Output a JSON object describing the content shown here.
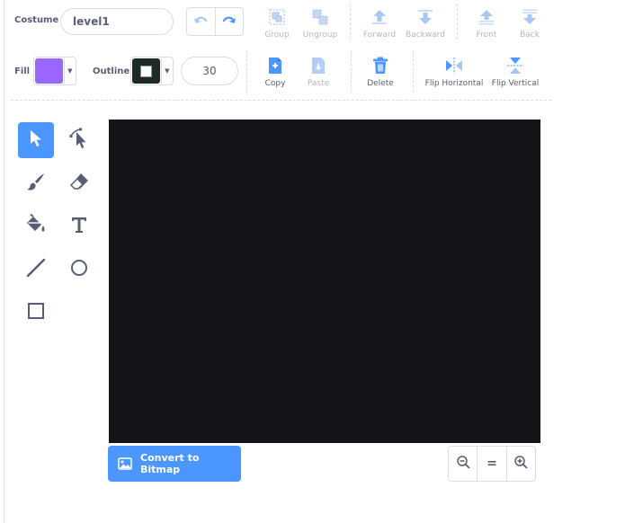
{
  "costume": {
    "label": "Costume",
    "name": "level1"
  },
  "toolbar": {
    "group": "Group",
    "ungroup": "Ungroup",
    "forward": "Forward",
    "backward": "Backward",
    "front": "Front",
    "back": "Back",
    "copy": "Copy",
    "paste": "Paste",
    "delete": "Delete",
    "flip_horizontal": "Flip Horizontal",
    "flip_vertical": "Flip Vertical"
  },
  "style": {
    "fill_label": "Fill",
    "fill_color": "#9966ff",
    "outline_label": "Outline",
    "outline_color": "#1e2a28",
    "outline_width": "30"
  },
  "tools": [
    "select-icon",
    "reshape-icon",
    "brush-icon",
    "eraser-icon",
    "fill-icon",
    "text-icon",
    "line-icon",
    "circle-icon",
    "rectangle-icon"
  ],
  "canvas": {
    "background": "#141519"
  },
  "convert_button": {
    "label": "Convert to Bitmap"
  },
  "zoom": {
    "out": "zoom-out-icon",
    "reset": "=",
    "in": "zoom-in-icon"
  },
  "colors": {
    "accent": "#4c97ff",
    "text": "#575e75",
    "disabled": "#b3b8c4"
  }
}
